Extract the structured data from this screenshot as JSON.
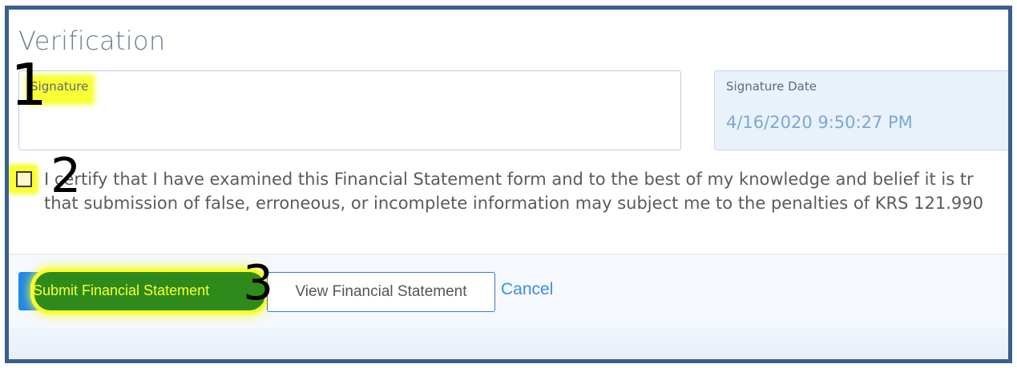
{
  "section": {
    "title": "Verification"
  },
  "signature": {
    "label": "Signature",
    "value": ""
  },
  "signature_date": {
    "label": "Signature Date",
    "value": "4/16/2020 9:50:27 PM"
  },
  "certification": {
    "checked": false,
    "line1": "I certify that I have examined this Financial Statement form and to the best of my knowledge and belief it is tr",
    "line2": "that submission of false, erroneous, or incomplete information may subject me to the penalties of KRS 121.990"
  },
  "actions": {
    "submit_label": "Submit Financial Statement",
    "view_label": "View Financial Statement",
    "cancel_label": "Cancel"
  },
  "annotations": {
    "marker1": "1",
    "marker2": "2",
    "marker3": "3"
  },
  "colors": {
    "highlight": "#f8ff33",
    "primary": "#1e88e5",
    "frame": "#3a5f8c"
  }
}
